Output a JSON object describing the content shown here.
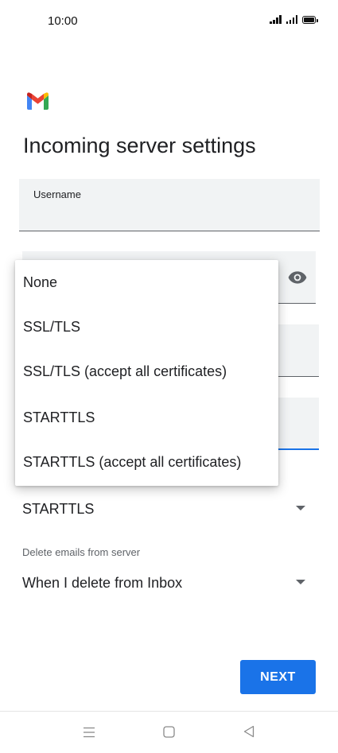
{
  "status_bar": {
    "time": "10:00",
    "icons": [
      "signal-icon",
      "signal-icon",
      "battery-icon"
    ]
  },
  "app": {
    "logo": "gmail-logo",
    "title": "Incoming server settings"
  },
  "form": {
    "username_label": "Username",
    "password_toggle_icon": "eye-icon",
    "security_type": {
      "selected": "STARTTLS",
      "options": [
        "None",
        "SSL/TLS",
        "SSL/TLS (accept all certificates)",
        "STARTTLS",
        "STARTTLS (accept all certificates)"
      ]
    },
    "delete_emails": {
      "label": "Delete emails from server",
      "selected": "When I delete from Inbox"
    }
  },
  "actions": {
    "next_label": "NEXT"
  },
  "colors": {
    "accent": "#1a73e8",
    "field_background": "#f1f3f4"
  },
  "nav_bar": {
    "icons": [
      "menu-icon",
      "home-icon",
      "back-icon"
    ]
  }
}
